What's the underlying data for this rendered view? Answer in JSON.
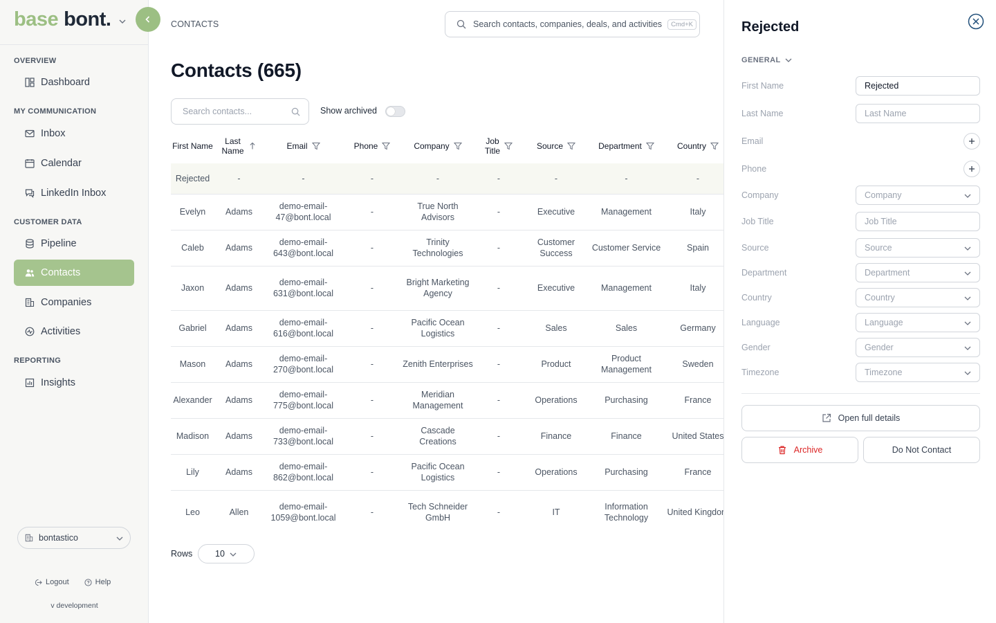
{
  "brand": {
    "part1": "base",
    "part2": "bont."
  },
  "breadcrumb": "CONTACTS",
  "search": {
    "placeholder": "Search contacts, companies, deals, and activities",
    "shortcut": "Cmd+K"
  },
  "sidebar": {
    "sections": {
      "overview": "OVERVIEW",
      "communication": "MY COMMUNICATION",
      "customer": "CUSTOMER DATA",
      "reporting": "REPORTING"
    },
    "items": [
      {
        "label": "Dashboard",
        "icon": "dashboard-icon"
      },
      {
        "label": "Inbox",
        "icon": "mail-icon"
      },
      {
        "label": "Calendar",
        "icon": "calendar-icon"
      },
      {
        "label": "LinkedIn Inbox",
        "icon": "chat-icon"
      },
      {
        "label": "Pipeline",
        "icon": "database-icon"
      },
      {
        "label": "Contacts",
        "icon": "users-icon",
        "active": true
      },
      {
        "label": "Companies",
        "icon": "building-icon"
      },
      {
        "label": "Activities",
        "icon": "activity-icon"
      },
      {
        "label": "Insights",
        "icon": "chart-icon"
      }
    ],
    "workspace": "bontastico",
    "logout": "Logout",
    "help": "Help",
    "version": "v development"
  },
  "main": {
    "title": "Contacts (665)",
    "search_placeholder": "Search contacts...",
    "show_archived": "Show archived",
    "rows_label": "Rows",
    "rows_value": "10",
    "columns": [
      {
        "line1": "First Name",
        "line2": ""
      },
      {
        "line1": "Last",
        "line2": "Name"
      },
      {
        "line1": "Email",
        "line2": ""
      },
      {
        "line1": "Phone",
        "line2": ""
      },
      {
        "line1": "Company",
        "line2": ""
      },
      {
        "line1": "Job",
        "line2": "Title"
      },
      {
        "line1": "Source",
        "line2": ""
      },
      {
        "line1": "Department",
        "line2": ""
      },
      {
        "line1": "Country",
        "line2": ""
      }
    ],
    "rows": [
      [
        "Rejected",
        "-",
        "-",
        "-",
        "-",
        "-",
        "-",
        "-",
        "-"
      ],
      [
        "Evelyn",
        "Adams",
        "demo-email-47@bont.local",
        "-",
        "True North Advisors",
        "-",
        "Executive",
        "Management",
        "Italy"
      ],
      [
        "Caleb",
        "Adams",
        "demo-email-643@bont.local",
        "-",
        "Trinity Technologies",
        "-",
        "Customer Success",
        "Customer Service",
        "Spain"
      ],
      [
        "Jaxon",
        "Adams",
        "demo-email-631@bont.local",
        "-",
        "Bright Marketing Agency",
        "-",
        "Executive",
        "Management",
        "Italy"
      ],
      [
        "Gabriel",
        "Adams",
        "demo-email-616@bont.local",
        "-",
        "Pacific Ocean Logistics",
        "-",
        "Sales",
        "Sales",
        "Germany"
      ],
      [
        "Mason",
        "Adams",
        "demo-email-270@bont.local",
        "-",
        "Zenith Enterprises",
        "-",
        "Product",
        "Product Management",
        "Sweden"
      ],
      [
        "Alexander",
        "Adams",
        "demo-email-775@bont.local",
        "-",
        "Meridian Management",
        "-",
        "Operations",
        "Purchasing",
        "France"
      ],
      [
        "Madison",
        "Adams",
        "demo-email-733@bont.local",
        "-",
        "Cascade Creations",
        "-",
        "Finance",
        "Finance",
        "United States"
      ],
      [
        "Lily",
        "Adams",
        "demo-email-862@bont.local",
        "-",
        "Pacific Ocean Logistics",
        "-",
        "Operations",
        "Purchasing",
        "France"
      ],
      [
        "Leo",
        "Allen",
        "demo-email-1059@bont.local",
        "-",
        "Tech Schneider GmbH",
        "-",
        "IT",
        "Information Technology",
        "United Kingdom"
      ]
    ]
  },
  "panel": {
    "title": "Rejected",
    "section": "GENERAL",
    "first_name_label": "First Name",
    "first_name_value": "Rejected",
    "last_name_label": "Last Name",
    "last_name_placeholder": "Last Name",
    "email_label": "Email",
    "phone_label": "Phone",
    "company_label": "Company",
    "company_placeholder": "Company",
    "job_title_label": "Job Title",
    "job_title_placeholder": "Job Title",
    "source_label": "Source",
    "source_placeholder": "Source",
    "department_label": "Department",
    "department_placeholder": "Department",
    "country_label": "Country",
    "country_placeholder": "Country",
    "language_label": "Language",
    "language_placeholder": "Language",
    "gender_label": "Gender",
    "gender_placeholder": "Gender",
    "timezone_label": "Timezone",
    "timezone_placeholder": "Timezone",
    "open_full_details": "Open full details",
    "archive": "Archive",
    "do_not_contact": "Do Not Contact"
  },
  "colors": {
    "accent": "#a5c48e",
    "danger": "#dc2626"
  }
}
